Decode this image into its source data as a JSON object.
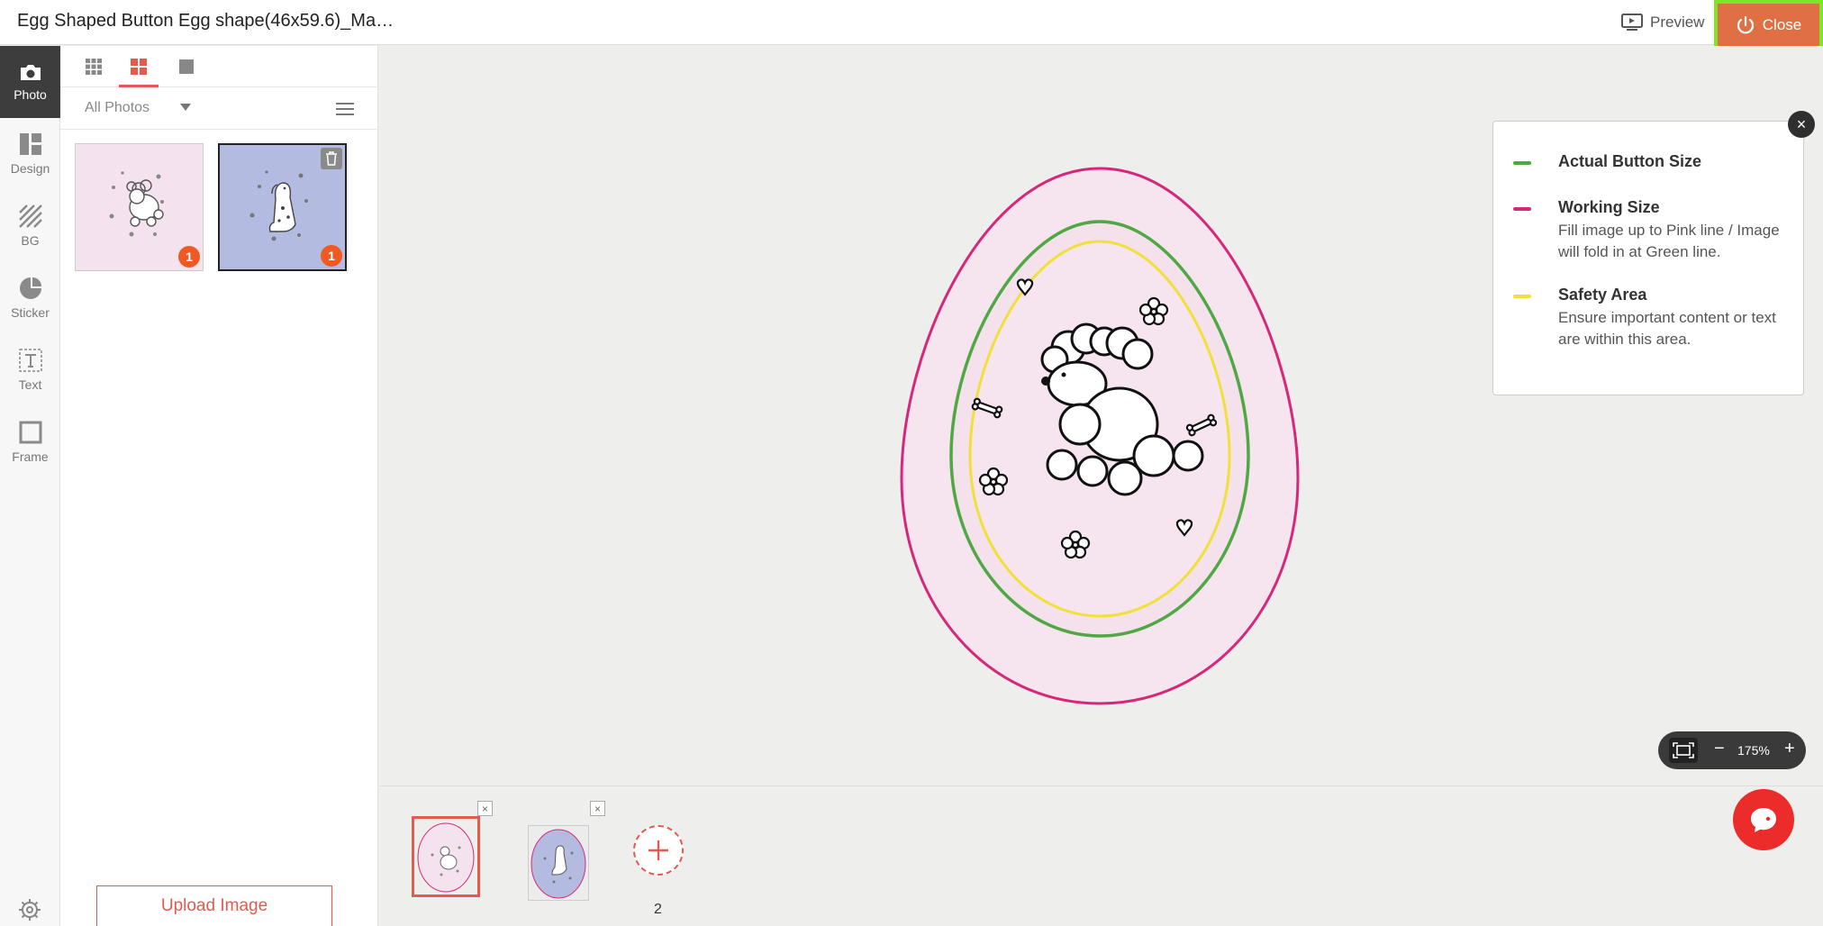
{
  "header": {
    "title": "Egg Shaped Button Egg shape(46x59.6)_Ma…",
    "preview_label": "Preview",
    "close_label": "Close"
  },
  "rail": {
    "items": [
      {
        "label": "Photo",
        "icon": "camera-icon",
        "active": true
      },
      {
        "label": "Design",
        "icon": "layout-icon"
      },
      {
        "label": "BG",
        "icon": "stripes-icon"
      },
      {
        "label": "Sticker",
        "icon": "sticker-icon"
      },
      {
        "label": "Text",
        "icon": "text-icon"
      },
      {
        "label": "Frame",
        "icon": "frame-icon"
      }
    ],
    "settings_icon": "gear-icon"
  },
  "photo_panel": {
    "view_tabs": [
      "small-grid-icon",
      "medium-grid-icon",
      "large-square-icon"
    ],
    "active_tab": 1,
    "filter_label": "All Photos",
    "photos": [
      {
        "name": "poodle-pink",
        "badge": "1",
        "selected": false,
        "bg": "#f4e3ef"
      },
      {
        "name": "dalmatian-blue",
        "badge": "1",
        "selected": true,
        "bg": "#b3bce0"
      }
    ],
    "upload_label": "Upload Image"
  },
  "legend": {
    "items": [
      {
        "title": "Actual Button Size",
        "desc": "",
        "color": "#4fa843"
      },
      {
        "title": "Working Size",
        "desc": "Fill image up to Pink line / Image will fold in at Green line.",
        "color": "#d6287a"
      },
      {
        "title": "Safety Area",
        "desc": "Ensure important content or text are within this area.",
        "color": "#f1e03a"
      }
    ],
    "close_glyph": "×"
  },
  "zoom": {
    "value": "175%",
    "minus": "−",
    "plus": "+"
  },
  "pages": {
    "count": "2",
    "delete_glyph": "×"
  },
  "colors": {
    "accent": "#e35b4f",
    "close_bg": "#e07044",
    "highlight": "#7ee62a"
  }
}
